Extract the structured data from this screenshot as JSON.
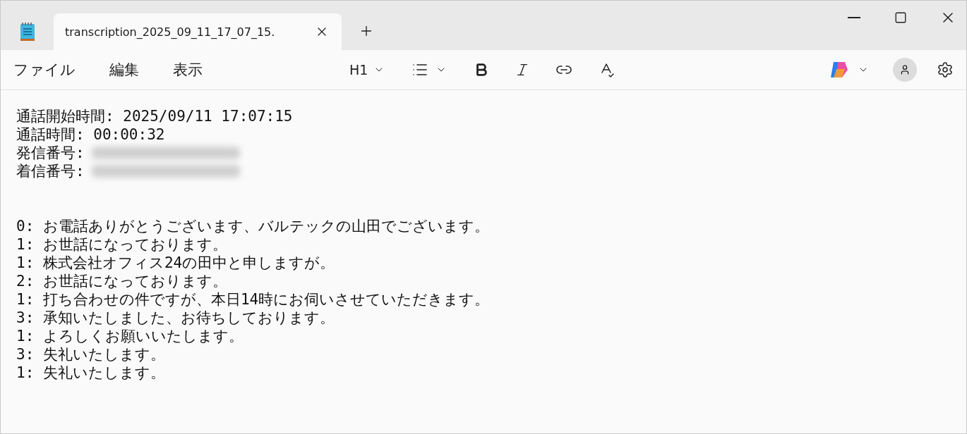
{
  "tab": {
    "title": "transcription_2025_09_11_17_07_15.",
    "selected": true
  },
  "menu": [
    "ファイル",
    "編集",
    "表示"
  ],
  "toolbar": {
    "heading": "H1"
  },
  "header_lines": [
    {
      "text": "通話開始時間: 2025/09/11 17:07:15",
      "redacted": false
    },
    {
      "text": "通話時間: 00:00:32",
      "redacted": false
    },
    {
      "text": "発信番号:",
      "redacted": true
    },
    {
      "text": "着信番号:",
      "redacted": true
    }
  ],
  "transcript": [
    "0: お電話ありがとうございます、バルテックの山田でございます。",
    "1: お世話になっております。",
    "1: 株式会社オフィス24の田中と申しますが。",
    "2: お世話になっております。",
    "1: 打ち合わせの件ですが、本日14時にお伺いさせていただきます。",
    "3: 承知いたしました、お待ちしております。",
    "1: よろしくお願いいたします。",
    "3: 失礼いたします。",
    "1: 失礼いたします。"
  ]
}
